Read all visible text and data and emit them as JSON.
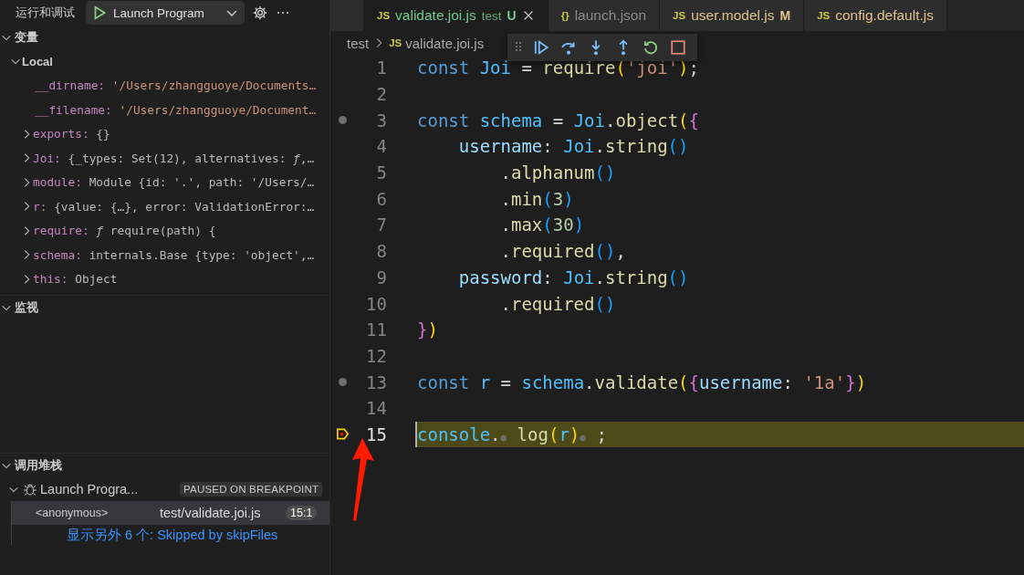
{
  "sidebar": {
    "title": "运行和调试",
    "launch_config": "Launch Program",
    "sections": [
      {
        "kind": "variables",
        "title": "变量",
        "expanded": true,
        "scopes": [
          {
            "label": "Local",
            "expanded": true,
            "variables": [
              {
                "name": "__dirname:",
                "value": "'/Users/zhangguoye/Documents…",
                "kind": "string"
              },
              {
                "name": "__filename:",
                "value": "'/Users/zhangguoye/Document…",
                "kind": "string"
              },
              {
                "name": "exports:",
                "value": "{}",
                "kind": "object",
                "expanded": false
              },
              {
                "name": "Joi:",
                "value": "{_types: Set(12), alternatives: *ƒ*,…",
                "kind": "object",
                "expanded": false
              },
              {
                "name": "module:",
                "value": "Module {id: '.', path: '/Users/…",
                "kind": "object",
                "expanded": false
              },
              {
                "name": "r:",
                "value": "{value: {…}, error: ValidationError:…",
                "kind": "object",
                "expanded": false
              },
              {
                "name": "require:",
                "value": "*ƒ* require(path) {",
                "kind": "object",
                "expanded": false
              },
              {
                "name": "schema:",
                "value": "internals.Base {type: 'object',…",
                "kind": "object",
                "expanded": false
              },
              {
                "name": "this:",
                "value": "Object",
                "kind": "object",
                "expanded": false
              }
            ]
          }
        ]
      },
      {
        "kind": "watch",
        "title": "监视",
        "expanded": true
      },
      {
        "kind": "callstack",
        "title": "调用堆栈",
        "expanded": true,
        "threads": [
          {
            "label": "Launch Progra...",
            "status": "PAUSED ON BREAKPOINT",
            "expanded": true,
            "frames": [
              {
                "name": "<anonymous>",
                "file": "test/validate.joi.js",
                "position": "15:1",
                "selected": true
              }
            ],
            "more_link": "显示另外 6 个: Skipped by skipFiles"
          }
        ]
      }
    ]
  },
  "tabs": [
    {
      "icon": "JS",
      "label": "validate.joi.js",
      "description": "test",
      "status": "U",
      "color": "#73c991",
      "selected": true
    },
    {
      "icon": "{}",
      "label": "launch.json",
      "color": "#8b8b8b",
      "selected": false
    },
    {
      "icon": "JS",
      "label": "user.model.js",
      "status": "M",
      "color": "#e2c08d",
      "selected": false
    },
    {
      "icon": "JS",
      "label": "config.default.js",
      "color": "#e2c08d",
      "selected": false
    }
  ],
  "breadcrumb": {
    "folder": "test",
    "icon": "JS",
    "file": "validate.joi.js"
  },
  "code": [
    {
      "number": "1",
      "kind": "plain",
      "current": false,
      "text": "const Joi = require('joi');"
    },
    {
      "number": "2",
      "kind": "plain",
      "current": false
    },
    {
      "number": "3",
      "kind": "hint",
      "current": false,
      "text": "const schema = Joi.object({"
    },
    {
      "number": "4",
      "kind": "plain",
      "current": false,
      "text": "    username: Joi.string()"
    },
    {
      "number": "5",
      "kind": "plain",
      "current": false,
      "text": "        .alphanum()"
    },
    {
      "number": "6",
      "kind": "plain",
      "current": false,
      "text": "        .min(3)"
    },
    {
      "number": "7",
      "kind": "plain",
      "current": false,
      "text": "        .max(30)"
    },
    {
      "number": "8",
      "kind": "plain",
      "current": false,
      "text": "        .required(),"
    },
    {
      "number": "9",
      "kind": "plain",
      "current": false,
      "text": "    password: Joi.string()"
    },
    {
      "number": "10",
      "kind": "plain",
      "current": false,
      "text": "        .required()"
    },
    {
      "number": "11",
      "kind": "plain",
      "current": false,
      "text": "})"
    },
    {
      "number": "12",
      "kind": "plain",
      "current": false
    },
    {
      "number": "13",
      "kind": "hint",
      "current": false,
      "text": "const r = schema.validate({username: '1a'})"
    },
    {
      "number": "14",
      "kind": "plain",
      "current": false
    },
    {
      "number": "15",
      "kind": "paused",
      "current": true,
      "text": "console.● log(r)● ;"
    }
  ]
}
